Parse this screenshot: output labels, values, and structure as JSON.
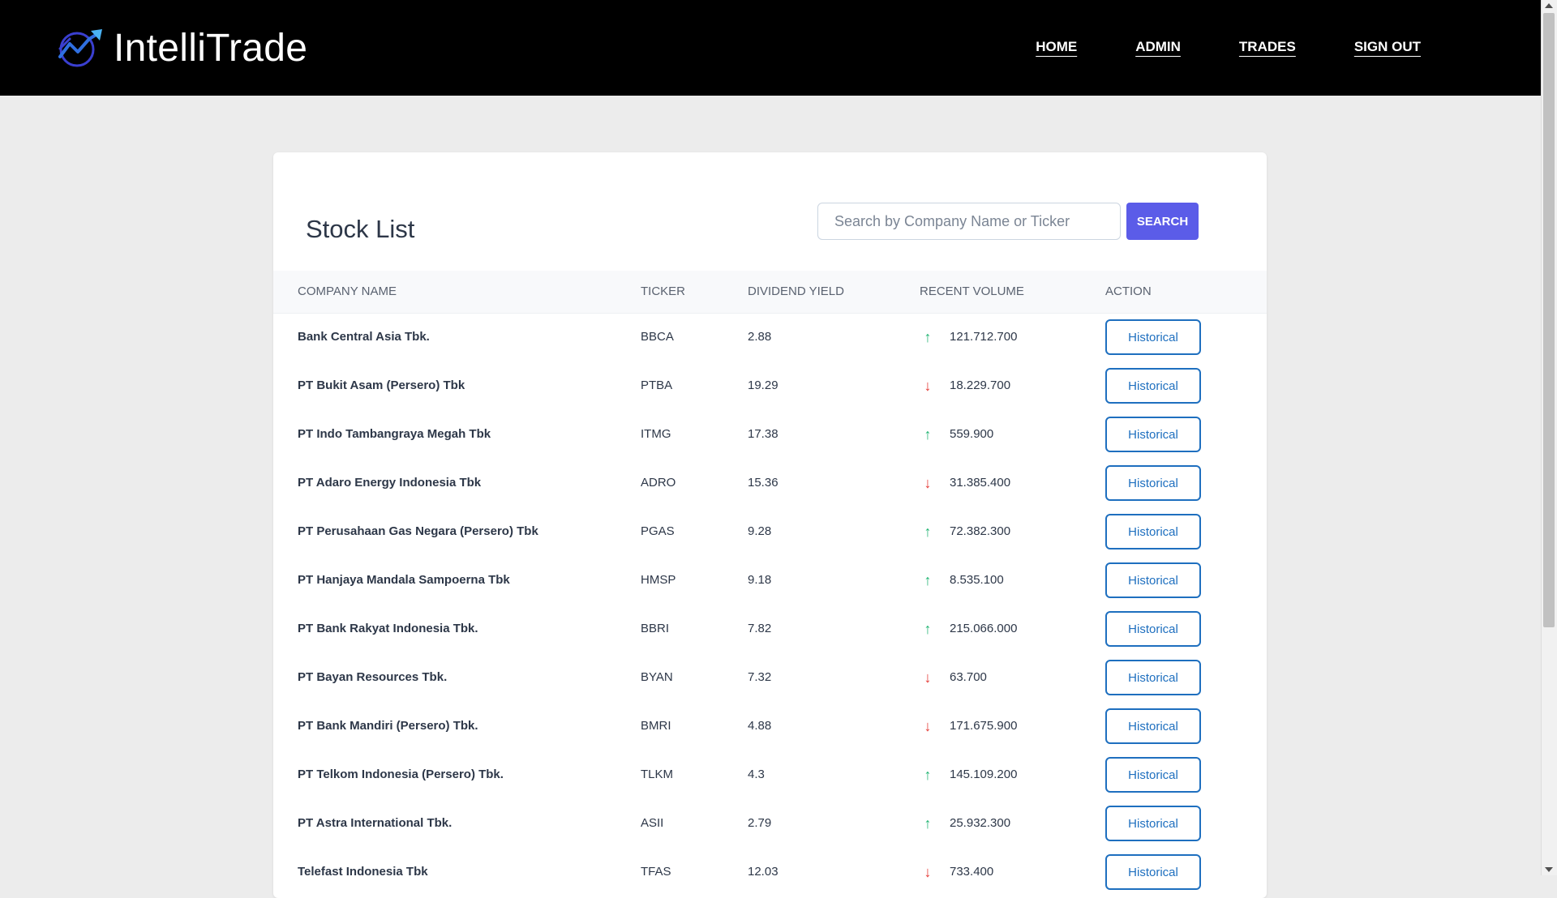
{
  "brand": {
    "name": "IntelliTrade"
  },
  "nav": {
    "items": [
      "HOME",
      "ADMIN",
      "TRADES",
      "SIGN OUT"
    ]
  },
  "page": {
    "title": "Stock List",
    "search_placeholder": "Search by Company Name or Ticker",
    "search_value": "",
    "search_button": "SEARCH"
  },
  "table": {
    "headers": [
      "COMPANY NAME",
      "TICKER",
      "DIVIDEND YIELD",
      "RECENT VOLUME",
      "ACTION"
    ],
    "rows": [
      {
        "name": "Bank Central Asia Tbk.",
        "ticker": "BBCA",
        "yield": "2.88",
        "trend": "up",
        "volume": "121.712.700",
        "action": "Historical"
      },
      {
        "name": "PT Bukit Asam (Persero) Tbk",
        "ticker": "PTBA",
        "yield": "19.29",
        "trend": "down",
        "volume": "18.229.700",
        "action": "Historical"
      },
      {
        "name": "PT Indo Tambangraya Megah Tbk",
        "ticker": "ITMG",
        "yield": "17.38",
        "trend": "up",
        "volume": "559.900",
        "action": "Historical"
      },
      {
        "name": "PT Adaro Energy Indonesia Tbk",
        "ticker": "ADRO",
        "yield": "15.36",
        "trend": "down",
        "volume": "31.385.400",
        "action": "Historical"
      },
      {
        "name": "PT Perusahaan Gas Negara (Persero) Tbk",
        "ticker": "PGAS",
        "yield": "9.28",
        "trend": "up",
        "volume": "72.382.300",
        "action": "Historical"
      },
      {
        "name": "PT Hanjaya Mandala Sampoerna Tbk",
        "ticker": "HMSP",
        "yield": "9.18",
        "trend": "up",
        "volume": "8.535.100",
        "action": "Historical"
      },
      {
        "name": "PT Bank Rakyat Indonesia Tbk.",
        "ticker": "BBRI",
        "yield": "7.82",
        "trend": "up",
        "volume": "215.066.000",
        "action": "Historical"
      },
      {
        "name": "PT Bayan Resources Tbk.",
        "ticker": "BYAN",
        "yield": "7.32",
        "trend": "down",
        "volume": "63.700",
        "action": "Historical"
      },
      {
        "name": "PT Bank Mandiri (Persero) Tbk.",
        "ticker": "BMRI",
        "yield": "4.88",
        "trend": "down",
        "volume": "171.675.900",
        "action": "Historical"
      },
      {
        "name": "PT Telkom Indonesia (Persero) Tbk.",
        "ticker": "TLKM",
        "yield": "4.3",
        "trend": "up",
        "volume": "145.109.200",
        "action": "Historical"
      },
      {
        "name": "PT Astra International Tbk.",
        "ticker": "ASII",
        "yield": "2.79",
        "trend": "up",
        "volume": "25.932.300",
        "action": "Historical"
      },
      {
        "name": "Telefast Indonesia Tbk",
        "ticker": "TFAS",
        "yield": "12.03",
        "trend": "down",
        "volume": "733.400",
        "action": "Historical"
      }
    ]
  },
  "colors": {
    "up": "#22b573",
    "down": "#e53935",
    "accent": "#5b5ce8",
    "link": "#1e6fbf"
  },
  "icons": {
    "logo": "chart-trend-logo-icon",
    "up": "arrow-up-icon",
    "down": "arrow-down-icon"
  }
}
